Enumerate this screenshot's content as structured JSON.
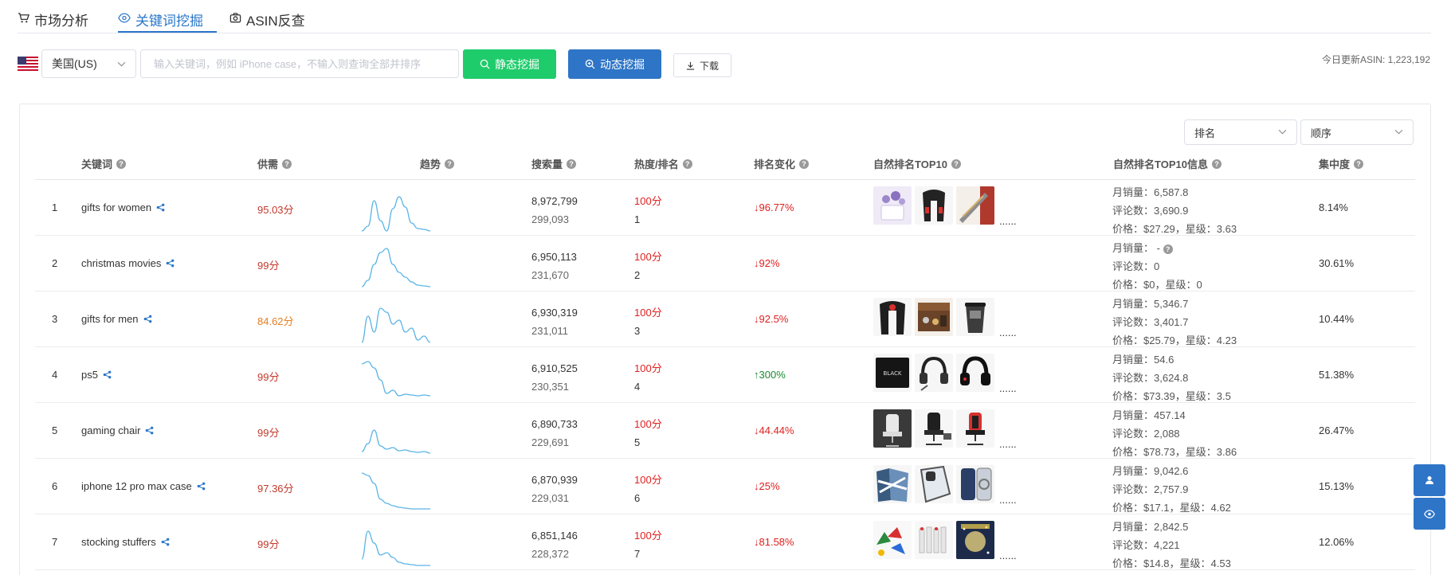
{
  "tabs": [
    {
      "label": "市场分析",
      "icon": "cart-icon"
    },
    {
      "label": "关键词挖掘",
      "icon": "eye-icon",
      "active": true
    },
    {
      "label": "ASIN反查",
      "icon": "camera-icon"
    }
  ],
  "toolbar": {
    "country": "美国(US)",
    "search_placeholder": "输入关键词，例如 iPhone case，不输入则查询全部并排序",
    "static_button": "静态挖掘",
    "dynamic_button": "动态挖掘",
    "download_button": "下载",
    "update_info": "今日更新ASIN: 1,223,192"
  },
  "sort": {
    "field": "排名",
    "order": "顺序"
  },
  "columns": [
    "关键词",
    "供需",
    "趋势",
    "搜索量",
    "热度/排名",
    "排名变化",
    "自然排名TOP10",
    "自然排名TOP10信息",
    "集中度"
  ],
  "rows": [
    {
      "idx": "1",
      "keyword": "gifts for women",
      "supply": "95.03分",
      "supply_level": "red",
      "search_volume": "8,972,799",
      "search_sub": "299,093",
      "heat": "100分",
      "rank": "1",
      "change": "↓96.77%",
      "dir": "down",
      "thumbs": [
        "lavender",
        "massager",
        "pen"
      ],
      "sales": "月销量：6,587.8",
      "reviews": "评论数：3,690.9",
      "price": "价格：$27.29，星级：3.63",
      "concentration": "8.14%",
      "trend": [
        58,
        52,
        20,
        45,
        58,
        30,
        15,
        28,
        48,
        55,
        56,
        58
      ]
    },
    {
      "idx": "2",
      "keyword": "christmas movies",
      "supply": "99分",
      "supply_level": "red",
      "search_volume": "6,950,113",
      "search_sub": "231,670",
      "heat": "100分",
      "rank": "2",
      "change": "↓92%",
      "dir": "down",
      "thumbs": [],
      "sales": "月销量：  -",
      "reviews": "评论数：0",
      "price": "价格：$0，星级：0",
      "concentration": "30.61%",
      "trend": [
        58,
        50,
        30,
        15,
        10,
        30,
        40,
        46,
        52,
        56,
        57,
        58
      ]
    },
    {
      "idx": "3",
      "keyword": "gifts for men",
      "supply": "84.62分",
      "supply_level": "orange",
      "search_volume": "6,930,319",
      "search_sub": "231,011",
      "heat": "100分",
      "rank": "3",
      "change": "↓92.5%",
      "dir": "down",
      "thumbs": [
        "neck",
        "wood-box",
        "tumbler"
      ],
      "sales": "月销量：5,346.7",
      "reviews": "评论数：3,401.7",
      "price": "价格：$25.79，星级：4.23",
      "concentration": "10.44%",
      "trend": [
        58,
        25,
        45,
        15,
        20,
        35,
        30,
        45,
        40,
        55,
        50,
        58
      ]
    },
    {
      "idx": "4",
      "keyword": "ps5",
      "supply": "99分",
      "supply_level": "red",
      "search_volume": "6,910,525",
      "search_sub": "230,351",
      "heat": "100分",
      "rank": "4",
      "change": "↑300%",
      "dir": "up",
      "thumbs": [
        "ssd",
        "headset-a",
        "headset-b"
      ],
      "sales": "月销量：54.6",
      "reviews": "评论数：3,624.8",
      "price": "价格：$73.39，星级：3.5",
      "concentration": "51.38%",
      "trend": [
        15,
        12,
        20,
        35,
        52,
        48,
        55,
        53,
        54,
        55,
        54,
        55
      ]
    },
    {
      "idx": "5",
      "keyword": "gaming chair",
      "supply": "99分",
      "supply_level": "red",
      "search_volume": "6,890,733",
      "search_sub": "229,691",
      "heat": "100分",
      "rank": "5",
      "change": "↓44.44%",
      "dir": "down",
      "thumbs": [
        "chair-white",
        "chair-black",
        "chair-red"
      ],
      "sales": "月销量：457.14",
      "reviews": "评论数：2,088",
      "price": "价格：$78.73，星级：3.86",
      "concentration": "26.47%",
      "trend": [
        55,
        45,
        28,
        48,
        52,
        50,
        54,
        53,
        55,
        56,
        55,
        57
      ]
    },
    {
      "idx": "6",
      "keyword": "iphone 12 pro max case",
      "supply": "97.36分",
      "supply_level": "red",
      "search_volume": "6,870,939",
      "search_sub": "229,031",
      "heat": "100分",
      "rank": "6",
      "change": "↓25%",
      "dir": "down",
      "thumbs": [
        "case-blue",
        "case-clear",
        "case-mag"
      ],
      "sales": "月销量：9,042.6",
      "reviews": "评论数：2,757.9",
      "price": "价格：$17.1，星级：4.62",
      "concentration": "15.13%",
      "trend": [
        12,
        15,
        25,
        45,
        50,
        53,
        55,
        56,
        57,
        57,
        57,
        57
      ]
    },
    {
      "idx": "7",
      "keyword": "stocking stuffers",
      "supply": "99分",
      "supply_level": "red",
      "search_volume": "6,851,146",
      "search_sub": "228,372",
      "heat": "100分",
      "rank": "7",
      "change": "↓81.58%",
      "dir": "down",
      "thumbs": [
        "toys",
        "tubes",
        "stars"
      ],
      "sales": "月销量：2,842.5",
      "reviews": "评论数：4,221",
      "price": "价格：$14.8，星级：4.53",
      "concentration": "12.06%",
      "trend": [
        50,
        15,
        30,
        45,
        42,
        48,
        54,
        56,
        57,
        58,
        58,
        58
      ]
    }
  ]
}
